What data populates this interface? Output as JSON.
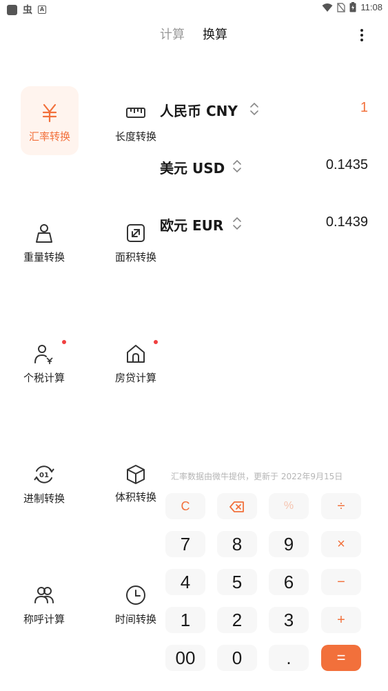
{
  "status_bar": {
    "time": "11:08",
    "left_glyph": "虫",
    "left_badge": "A"
  },
  "tabs": [
    {
      "label": "计算",
      "active": false
    },
    {
      "label": "换算",
      "active": true
    }
  ],
  "tools": [
    {
      "label": "汇率转换",
      "icon": "yuan-icon",
      "active": true
    },
    {
      "label": "长度转换",
      "icon": "ruler-icon"
    },
    {
      "label": "重量转换",
      "icon": "weight-icon"
    },
    {
      "label": "面积转换",
      "icon": "area-icon"
    },
    {
      "label": "个税计算",
      "icon": "tax-person-icon",
      "badge": true
    },
    {
      "label": "房贷计算",
      "icon": "house-icon",
      "badge": true
    },
    {
      "label": "进制转换",
      "icon": "base-convert-icon"
    },
    {
      "label": "体积转换",
      "icon": "cube-icon"
    },
    {
      "label": "称呼计算",
      "icon": "people-icon"
    },
    {
      "label": "时间转换",
      "icon": "clock-icon"
    }
  ],
  "currencies": [
    {
      "name": "人民币 CNY",
      "value": "1",
      "active": true
    },
    {
      "name": "美元 USD",
      "value": "0.1435"
    },
    {
      "name": "欧元 EUR",
      "value": "0.1439"
    }
  ],
  "source_note": "汇率数据由微牛提供，更新于 2022年9月15日",
  "keypad": {
    "clear": "C",
    "backspace_icon": "backspace-icon",
    "percent": "%",
    "divide": "÷",
    "multiply": "×",
    "minus": "−",
    "plus": "+",
    "equals": "=",
    "k7": "7",
    "k8": "8",
    "k9": "9",
    "k4": "4",
    "k5": "5",
    "k6": "6",
    "k1": "1",
    "k2": "2",
    "k3": "3",
    "k00": "00",
    "k0": "0",
    "kdot": "."
  },
  "colors": {
    "accent": "#f2703b",
    "badge": "#f04040",
    "key_bg": "#f7f7f7"
  }
}
